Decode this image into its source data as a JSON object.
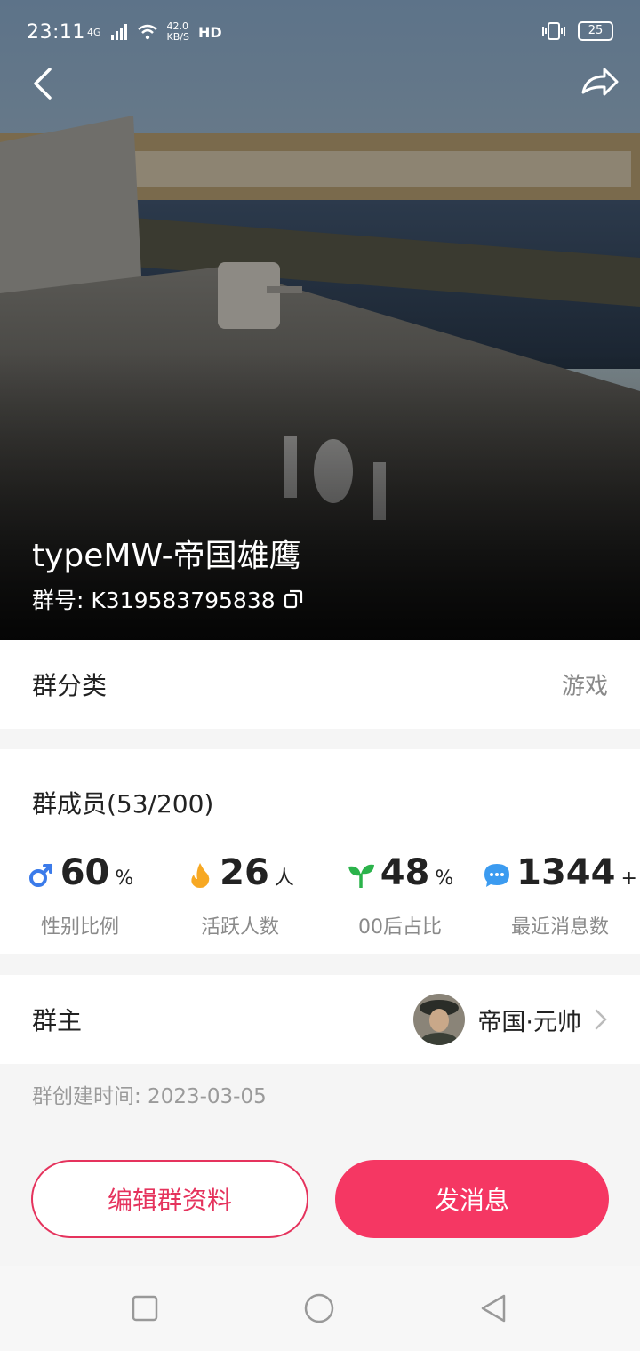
{
  "status_bar": {
    "time": "23:11",
    "network": "4G",
    "speed_value": "42.0",
    "speed_unit": "KB/S",
    "hd": "HD",
    "battery": "25"
  },
  "header": {
    "group_name": "typeMW-帝国雄鹰",
    "group_id_label": "群号: K319583795838"
  },
  "category": {
    "label": "群分类",
    "value": "游戏"
  },
  "members": {
    "title": "群成员(53/200)",
    "stats": [
      {
        "icon": "male-gender-icon",
        "value": "60",
        "unit": "%",
        "label": "性别比例",
        "color": "#3b7bea"
      },
      {
        "icon": "flame-icon",
        "value": "26",
        "unit": "人",
        "label": "活跃人数",
        "color": "#f7a823"
      },
      {
        "icon": "sprout-icon",
        "value": "48",
        "unit": "%",
        "label": "00后占比",
        "color": "#2bb34b"
      },
      {
        "icon": "chat-bubble-icon",
        "value": "1344",
        "unit": "+",
        "label": "最近消息数",
        "color": "#3b9bf0"
      }
    ]
  },
  "owner": {
    "label": "群主",
    "name": "帝国·元帅"
  },
  "created": "群创建时间: 2023-03-05",
  "actions": {
    "edit_label": "编辑群资料",
    "send_label": "发消息"
  },
  "colors": {
    "accent": "#f53763",
    "accent_border": "#e5335d"
  }
}
